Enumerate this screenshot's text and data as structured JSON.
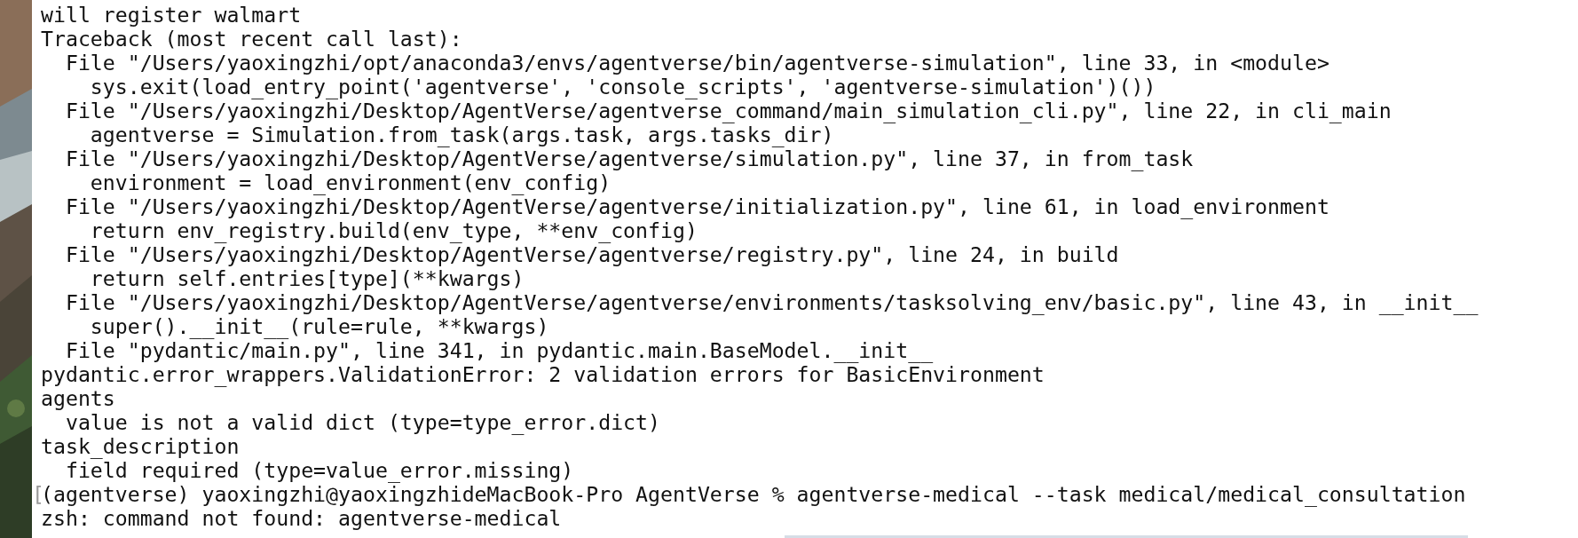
{
  "terminal": {
    "lines": [
      {
        "text": "will register walmart"
      },
      {
        "text": "Traceback (most recent call last):"
      },
      {
        "text": "  File \"/Users/yaoxingzhi/opt/anaconda3/envs/agentverse/bin/agentverse-simulation\", line 33, in <module>"
      },
      {
        "text": "    sys.exit(load_entry_point('agentverse', 'console_scripts', 'agentverse-simulation')())"
      },
      {
        "text": "  File \"/Users/yaoxingzhi/Desktop/AgentVerse/agentverse_command/main_simulation_cli.py\", line 22, in cli_main"
      },
      {
        "text": "    agentverse = Simulation.from_task(args.task, args.tasks_dir)"
      },
      {
        "text": "  File \"/Users/yaoxingzhi/Desktop/AgentVerse/agentverse/simulation.py\", line 37, in from_task"
      },
      {
        "text": "    environment = load_environment(env_config)"
      },
      {
        "text": "  File \"/Users/yaoxingzhi/Desktop/AgentVerse/agentverse/initialization.py\", line 61, in load_environment"
      },
      {
        "text": "    return env_registry.build(env_type, **env_config)"
      },
      {
        "text": "  File \"/Users/yaoxingzhi/Desktop/AgentVerse/agentverse/registry.py\", line 24, in build"
      },
      {
        "text": "    return self.entries[type](**kwargs)"
      },
      {
        "text": "  File \"/Users/yaoxingzhi/Desktop/AgentVerse/agentverse/environments/tasksolving_env/basic.py\", line 43, in __init__"
      },
      {
        "text": "    super().__init__(rule=rule, **kwargs)"
      },
      {
        "text": "  File \"pydantic/main.py\", line 341, in pydantic.main.BaseModel.__init__"
      },
      {
        "text": "pydantic.error_wrappers.ValidationError: 2 validation errors for BasicEnvironment"
      },
      {
        "text": "agents"
      },
      {
        "text": "  value is not a valid dict (type=type_error.dict)"
      },
      {
        "text": "task_description"
      },
      {
        "text": "  field required (type=value_error.missing)"
      },
      {
        "text": "(agentverse) yaoxingzhi@yaoxingzhideMacBook-Pro AgentVerse % agentverse-medical --task medical/medical_consultation",
        "mark": "["
      },
      {
        "text": "zsh: command not found: agentverse-medical"
      }
    ]
  }
}
